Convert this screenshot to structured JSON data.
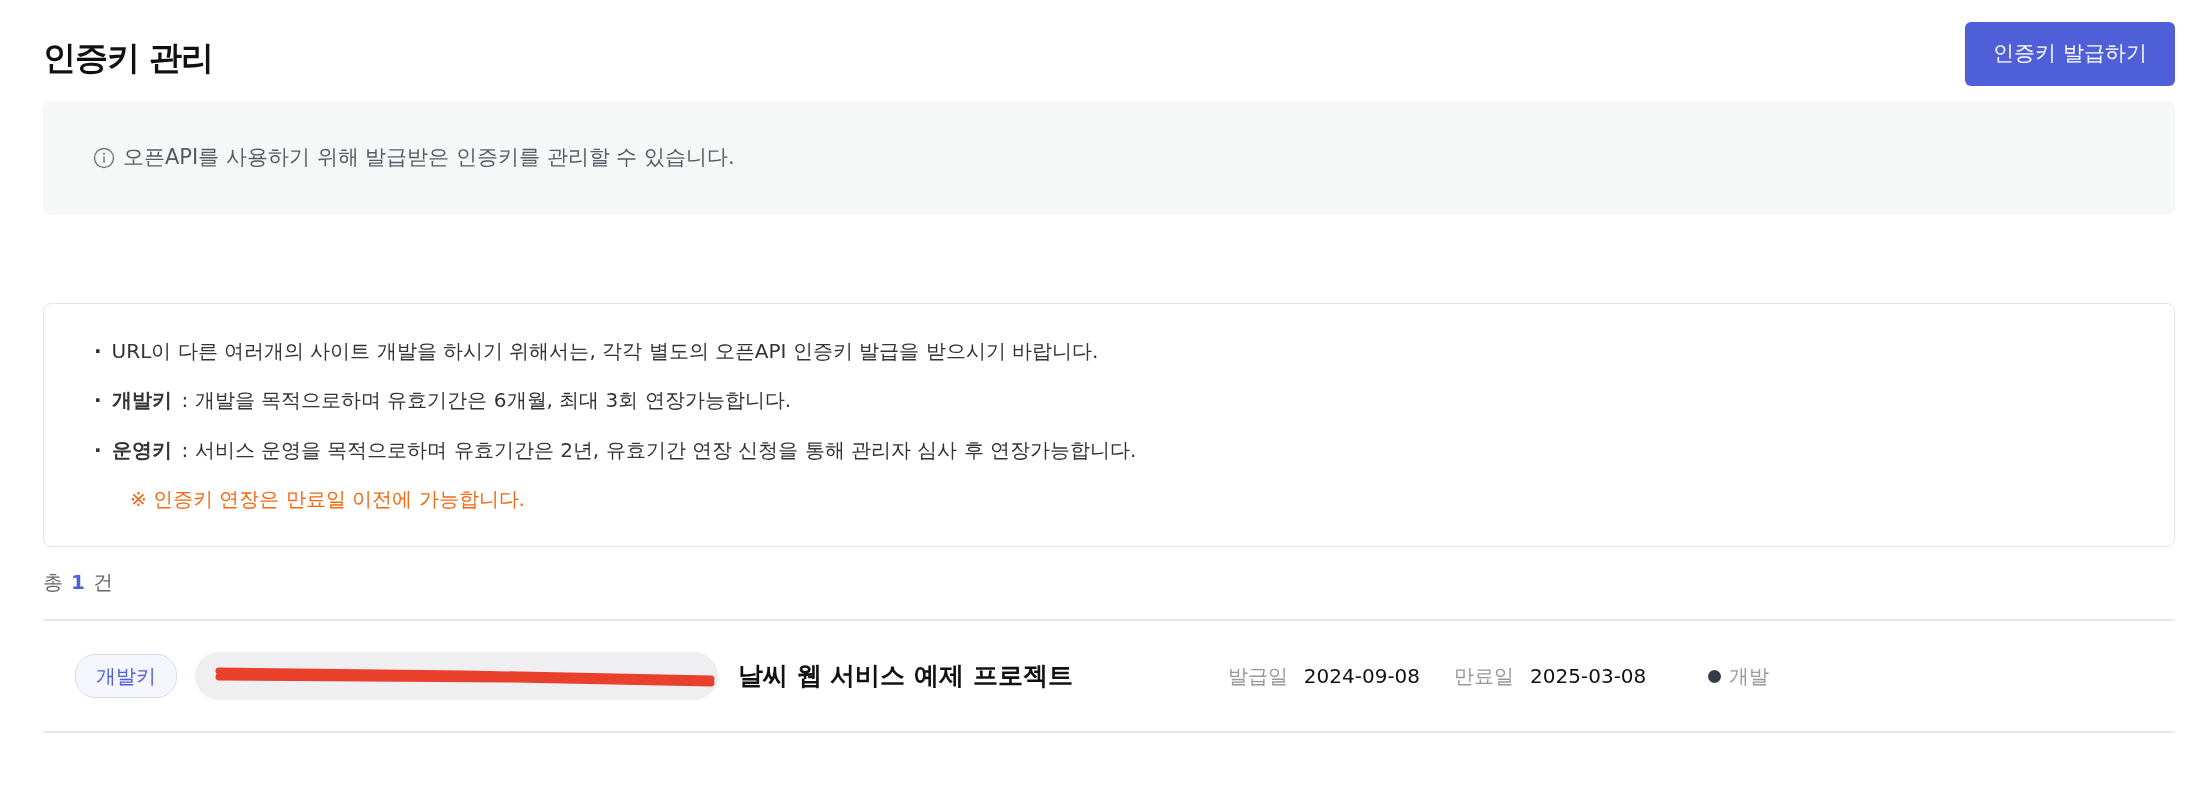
{
  "page": {
    "title": "인증키 관리",
    "issue_button": "인증키 발급하기"
  },
  "info": {
    "text": "오픈API를 사용하기 위해 발급받은 인증키를 관리할 수 있습니다."
  },
  "notes": [
    {
      "kind": "bullet",
      "marker": "·",
      "text": "URL이 다른 여러개의 사이트 개발을 하시기 위해서는, 각각 별도의 오픈API 인증키 발급을 받으시기 바랍니다."
    },
    {
      "kind": "term",
      "marker": "·",
      "term": "개발키",
      "text": ": 개발을 목적으로하며 유효기간은 6개월, 최대 3회 연장가능합니다."
    },
    {
      "kind": "term",
      "marker": "·",
      "term": "운영키",
      "text": ": 서비스 운영을 목적으로하며 유효기간은 2년, 유효기간 연장 신청을 통해 관리자 심사 후 연장가능합니다."
    },
    {
      "kind": "warning",
      "text": "※ 인증키 연장은 만료일 이전에 가능합니다."
    }
  ],
  "total": {
    "prefix": "총",
    "count": "1",
    "suffix": "건"
  },
  "keys": [
    {
      "type": "개발키",
      "key_redacted": true,
      "project": "날씨 웹 서비스 예제 프로젝트",
      "issued_label": "발급일",
      "issued": "2024-09-08",
      "expires_label": "만료일",
      "expires": "2025-03-08",
      "status": {
        "label": "개발",
        "color": "#343a46"
      }
    }
  ]
}
